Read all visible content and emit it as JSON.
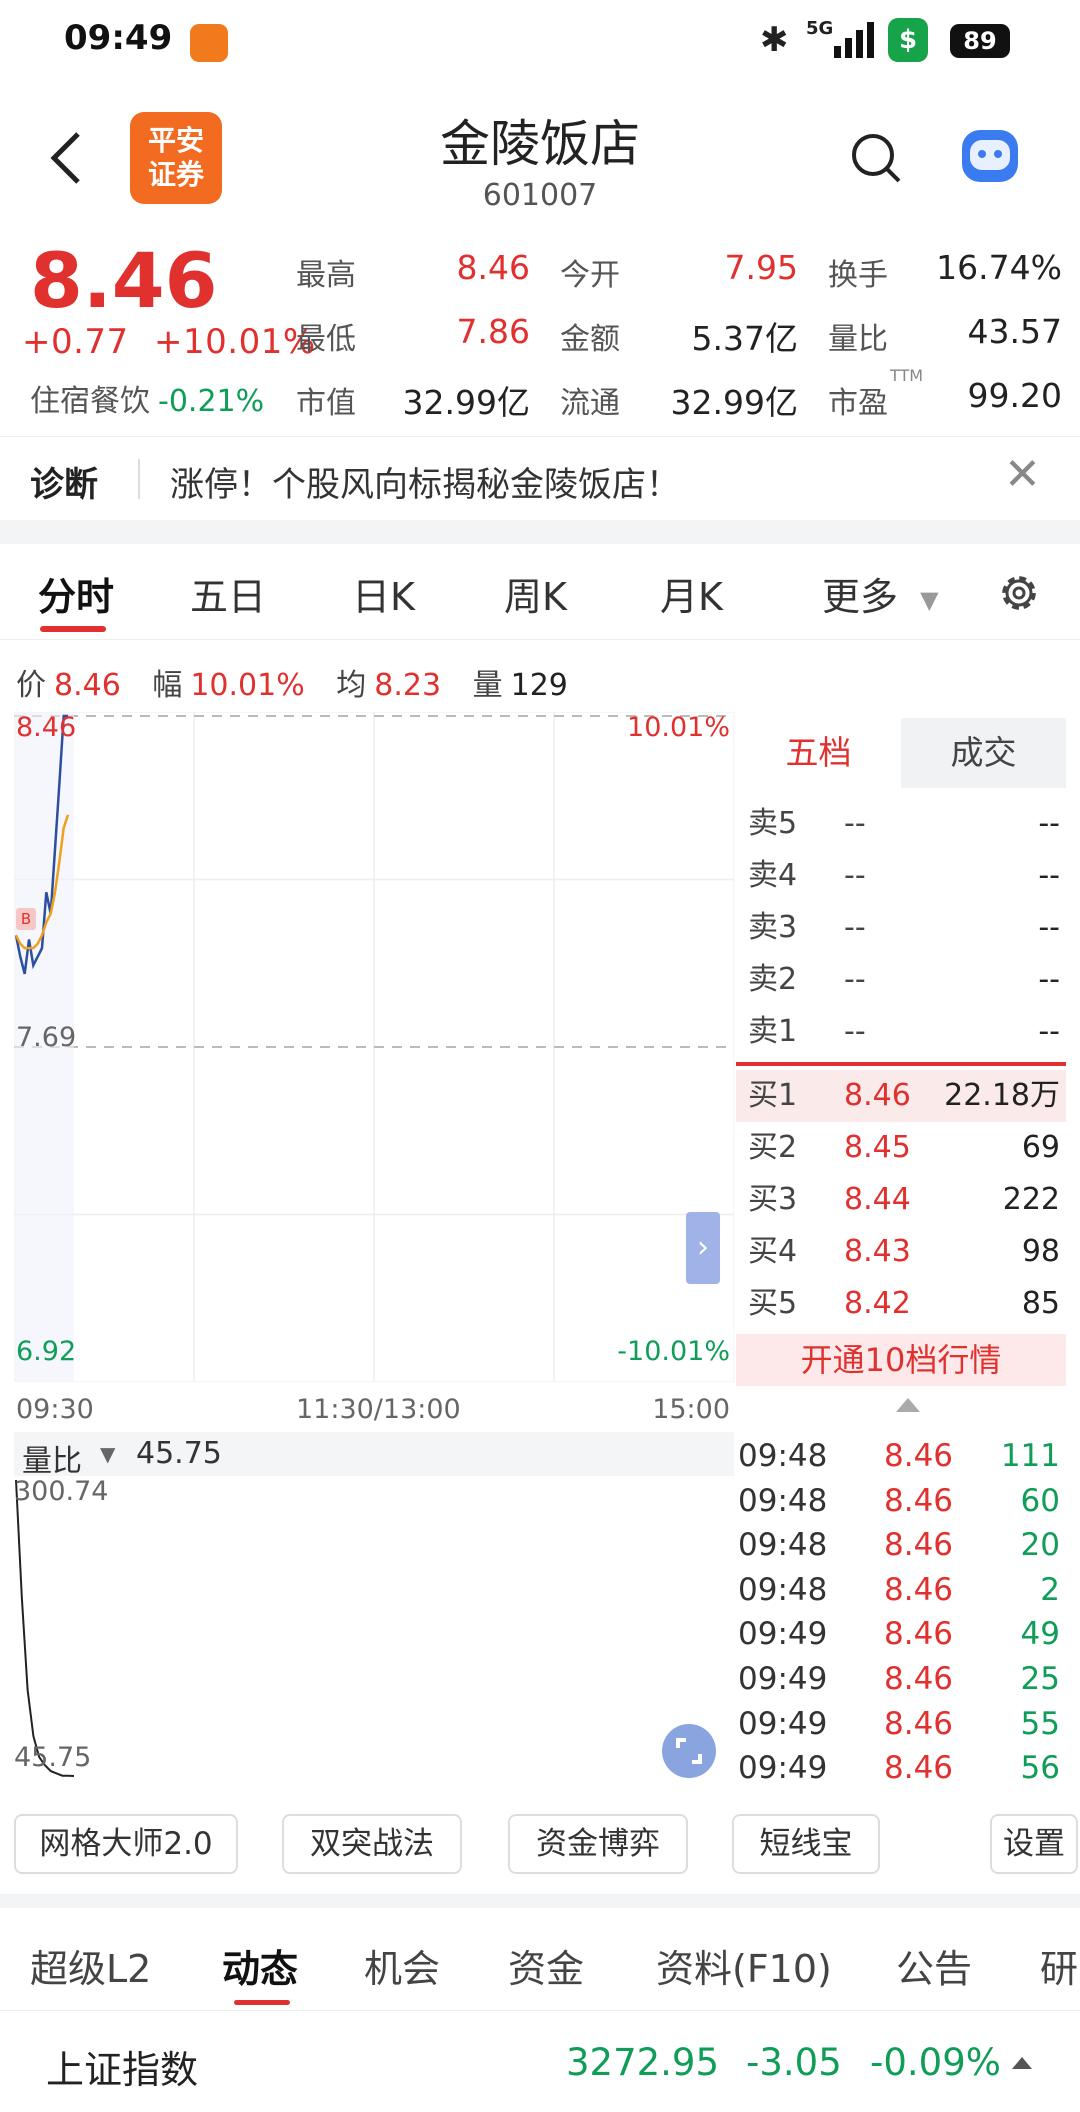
{
  "status_bar": {
    "time": "09:49",
    "network": "5G",
    "battery": "89"
  },
  "header": {
    "title": "金陵饭店",
    "code": "601007",
    "logo_text": [
      "平安",
      "证券"
    ]
  },
  "quote": {
    "price": "8.46",
    "change": "+0.77",
    "change_pct": "+10.01%",
    "sector": "住宿餐饮",
    "sector_pct": "-0.21%",
    "stats": [
      {
        "label": "最高",
        "value": "8.46",
        "color": "#e0312f"
      },
      {
        "label": "今开",
        "value": "7.95",
        "color": "#e0312f"
      },
      {
        "label": "换手",
        "value": "16.74%",
        "color": "#222222"
      },
      {
        "label": "最低",
        "value": "7.86",
        "color": "#e0312f"
      },
      {
        "label": "金额",
        "value": "5.37亿",
        "color": "#222222"
      },
      {
        "label": "量比",
        "value": "43.57",
        "color": "#222222"
      },
      {
        "label": "市值",
        "value": "32.99亿",
        "color": "#222222"
      },
      {
        "label": "流通",
        "value": "32.99亿",
        "color": "#222222"
      },
      {
        "label": "市盈",
        "value": "99.20",
        "color": "#222222",
        "sup": "TTM"
      }
    ]
  },
  "diagnosis": {
    "label": "诊断",
    "text": "涨停！个股风向标揭秘金陵饭店！"
  },
  "period_tabs": [
    {
      "label": "分时",
      "active": true
    },
    {
      "label": "五日",
      "active": false
    },
    {
      "label": "日K",
      "active": false
    },
    {
      "label": "周K",
      "active": false
    },
    {
      "label": "月K",
      "active": false
    },
    {
      "label": "更多",
      "active": false
    }
  ],
  "info_line": {
    "price_label": "价",
    "price": "8.46",
    "amp_label": "幅",
    "amp": "10.01%",
    "avg_label": "均",
    "avg": "8.23",
    "vol_label": "量",
    "vol": "129"
  },
  "chart_data": {
    "type": "line",
    "y_labels": {
      "top": "8.46",
      "mid": "7.69",
      "bottom": "6.92"
    },
    "pct_labels": {
      "top": "10.01%",
      "bottom": "-10.01%"
    },
    "ylim": [
      6.92,
      8.46
    ],
    "x_labels": [
      "09:30",
      "11:30/13:00",
      "15:00"
    ],
    "marker": "B",
    "series": [
      {
        "values": [
          7.95,
          7.9,
          7.86,
          7.94,
          7.88,
          7.9,
          7.92,
          8.05,
          8.0,
          8.15,
          8.3,
          8.46,
          8.46
        ]
      },
      {
        "values": [
          7.95,
          7.93,
          7.92,
          7.92,
          7.92,
          7.93,
          7.95,
          7.98,
          8.0,
          8.05,
          8.12,
          8.2,
          8.23
        ]
      }
    ]
  },
  "volume_ratio": {
    "label": "量比",
    "value": "45.75",
    "top_label": "300.74",
    "bottom_label": "45.75",
    "values": [
      300.74,
      200,
      120,
      80,
      62,
      55,
      50,
      48,
      46,
      46,
      45.75
    ]
  },
  "order_book": {
    "tabs": [
      {
        "label": "五档",
        "active": true
      },
      {
        "label": "成交",
        "active": false
      }
    ],
    "asks": [
      {
        "label": "卖5",
        "price": "--",
        "volume": "--"
      },
      {
        "label": "卖4",
        "price": "--",
        "volume": "--"
      },
      {
        "label": "卖3",
        "price": "--",
        "volume": "--"
      },
      {
        "label": "卖2",
        "price": "--",
        "volume": "--"
      },
      {
        "label": "卖1",
        "price": "--",
        "volume": "--"
      }
    ],
    "bids": [
      {
        "label": "买1",
        "price": "8.46",
        "volume": "22.18万"
      },
      {
        "label": "买2",
        "price": "8.45",
        "volume": "69"
      },
      {
        "label": "买3",
        "price": "8.44",
        "volume": "222"
      },
      {
        "label": "买4",
        "price": "8.43",
        "volume": "98"
      },
      {
        "label": "买5",
        "price": "8.42",
        "volume": "85"
      }
    ],
    "upgrade": "开通10档行情"
  },
  "ticks": [
    {
      "time": "09:48",
      "price": "8.46",
      "volume": "111"
    },
    {
      "time": "09:48",
      "price": "8.46",
      "volume": "60"
    },
    {
      "time": "09:48",
      "price": "8.46",
      "volume": "20"
    },
    {
      "time": "09:48",
      "price": "8.46",
      "volume": "2"
    },
    {
      "time": "09:49",
      "price": "8.46",
      "volume": "49"
    },
    {
      "time": "09:49",
      "price": "8.46",
      "volume": "25"
    },
    {
      "time": "09:49",
      "price": "8.46",
      "volume": "55"
    },
    {
      "time": "09:49",
      "price": "8.46",
      "volume": "56"
    }
  ],
  "tools": [
    "网格大师2.0",
    "双突战法",
    "资金博弈",
    "短线宝",
    "设置"
  ],
  "bottom_tabs": [
    {
      "label": "超级L2",
      "active": false
    },
    {
      "label": "动态",
      "active": true
    },
    {
      "label": "机会",
      "active": false
    },
    {
      "label": "资金",
      "active": false
    },
    {
      "label": "资料(F10)",
      "active": false
    },
    {
      "label": "公告",
      "active": false
    },
    {
      "label": "研",
      "active": false
    }
  ],
  "index_bar": {
    "name": "上证指数",
    "value": "3272.95",
    "change": "-3.05",
    "change_pct": "-0.09%"
  },
  "colors": {
    "up": "#e0312f",
    "down": "#0f9d58",
    "price_line": "#2c4f9e",
    "avg_line": "#f0a020"
  }
}
